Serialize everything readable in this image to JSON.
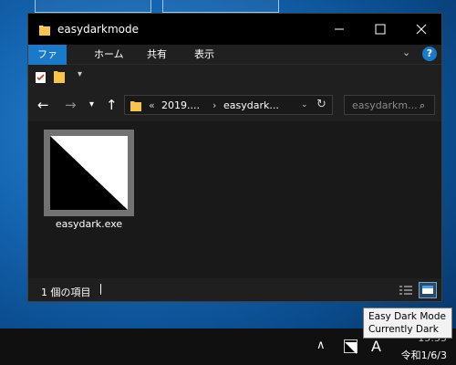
{
  "window": {
    "title": "easydarkmode"
  },
  "ribbon": {
    "tabs": [
      "ファイル",
      "ホーム",
      "共有",
      "表示"
    ]
  },
  "address": {
    "overflow": "«",
    "segments": [
      "2019....",
      "easydark..."
    ]
  },
  "search": {
    "placeholder": "easydarkm..."
  },
  "files": [
    {
      "name": "easydark.exe"
    }
  ],
  "status": {
    "item_count": "1 個の項目"
  },
  "tooltip": {
    "line1": "Easy Dark Mode",
    "line2": "Currently Dark"
  },
  "tray": {
    "ime": "A",
    "time": "15:55",
    "date": "令和1/6/3"
  },
  "colors": {
    "accent": "#1979ca",
    "titlebar": "#000000",
    "panel": "#1f1f1f",
    "content": "#191919"
  }
}
